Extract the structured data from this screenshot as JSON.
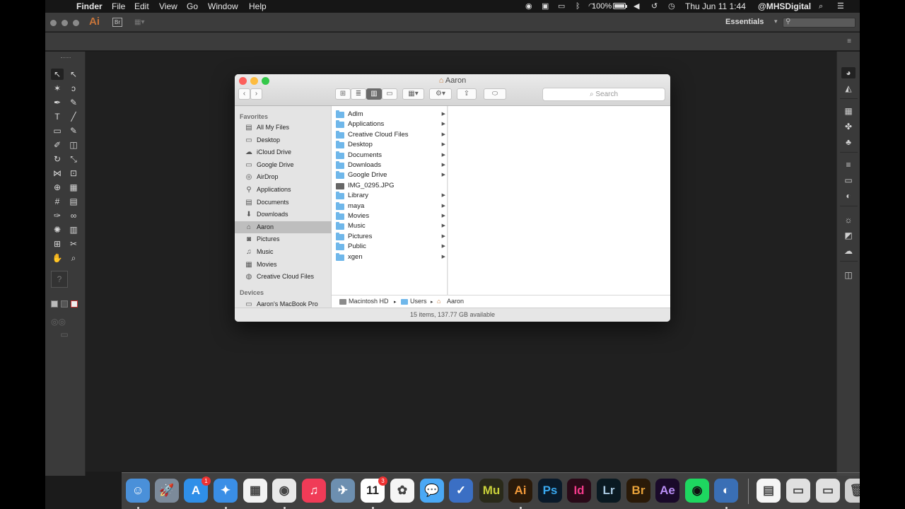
{
  "menubar": {
    "apple": "",
    "app_name": "Finder",
    "menus": [
      "File",
      "Edit",
      "View",
      "Go",
      "Window",
      "Help"
    ],
    "battery": "100%",
    "clock": "Thu Jun 11  1:44",
    "user": "@MHSDigital"
  },
  "illustrator": {
    "logo": "Ai",
    "bridge": "Br",
    "workspace": "Essentials",
    "search_placeholder": "⚲"
  },
  "finder": {
    "title": "Aaron",
    "search_placeholder": "Search",
    "sidebar": {
      "favorites_header": "Favorites",
      "favorites": [
        {
          "label": "All My Files",
          "icon": "all-files-icon"
        },
        {
          "label": "Desktop",
          "icon": "desktop-icon"
        },
        {
          "label": "iCloud Drive",
          "icon": "cloud-icon"
        },
        {
          "label": "Google Drive",
          "icon": "drive-icon"
        },
        {
          "label": "AirDrop",
          "icon": "airdrop-icon"
        },
        {
          "label": "Applications",
          "icon": "applications-icon"
        },
        {
          "label": "Documents",
          "icon": "documents-icon"
        },
        {
          "label": "Downloads",
          "icon": "downloads-icon"
        },
        {
          "label": "Aaron",
          "icon": "home-icon"
        },
        {
          "label": "Pictures",
          "icon": "camera-icon"
        },
        {
          "label": "Music",
          "icon": "music-icon"
        },
        {
          "label": "Movies",
          "icon": "film-icon"
        },
        {
          "label": "Creative Cloud Files",
          "icon": "creative-cloud-icon"
        }
      ],
      "devices_header": "Devices",
      "devices": [
        {
          "label": "Aaron's MacBook Pro",
          "icon": "laptop-icon"
        }
      ]
    },
    "items": [
      {
        "name": "Adlm",
        "folder": true
      },
      {
        "name": "Applications",
        "folder": true
      },
      {
        "name": "Creative Cloud Files",
        "folder": true
      },
      {
        "name": "Desktop",
        "folder": true
      },
      {
        "name": "Documents",
        "folder": true
      },
      {
        "name": "Downloads",
        "folder": true
      },
      {
        "name": "Google Drive",
        "folder": true
      },
      {
        "name": "IMG_0295.JPG",
        "folder": false
      },
      {
        "name": "Library",
        "folder": true
      },
      {
        "name": "maya",
        "folder": true
      },
      {
        "name": "Movies",
        "folder": true
      },
      {
        "name": "Music",
        "folder": true
      },
      {
        "name": "Pictures",
        "folder": true
      },
      {
        "name": "Public",
        "folder": true
      },
      {
        "name": "xgen",
        "folder": true
      }
    ],
    "path": [
      "Macintosh HD",
      "Users",
      "Aaron"
    ],
    "status": "15 items, 137.77 GB available"
  },
  "dock": {
    "apps": [
      {
        "name": "finder-dock-icon",
        "label": "",
        "color": "#4a90d9",
        "text_color": "#fff",
        "running": true
      },
      {
        "name": "launchpad-dock-icon",
        "label": "",
        "color": "#7c8a9a",
        "text_color": "#fff",
        "running": false
      },
      {
        "name": "app-store-dock-icon",
        "label": "A",
        "color": "#2f8fe8",
        "text_color": "#fff",
        "badge": "1",
        "running": false
      },
      {
        "name": "safari-dock-icon",
        "label": "",
        "color": "#3a8ee6",
        "text_color": "#fff",
        "running": true
      },
      {
        "name": "grid-app-dock-icon",
        "label": "",
        "color": "#f2f2f2",
        "text_color": "#444",
        "running": false
      },
      {
        "name": "chrome-dock-icon",
        "label": "",
        "color": "#e8e8e8",
        "text_color": "#444",
        "running": true
      },
      {
        "name": "itunes-dock-icon",
        "label": "♫",
        "color": "#f03b57",
        "text_color": "#fff",
        "running": false
      },
      {
        "name": "preview-dock-icon",
        "label": "",
        "color": "#6d8fb0",
        "text_color": "#fff",
        "running": false
      },
      {
        "name": "calendar-dock-icon",
        "label": "11",
        "color": "#ffffff",
        "text_color": "#222",
        "badge": "3",
        "running": true
      },
      {
        "name": "photos-dock-icon",
        "label": "",
        "color": "#f5f5f5",
        "text_color": "#444",
        "running": false
      },
      {
        "name": "messages-dock-icon",
        "label": "",
        "color": "#4aa8f5",
        "text_color": "#fff",
        "running": false
      },
      {
        "name": "tasks-dock-icon",
        "label": "✓",
        "color": "#3b6fc4",
        "text_color": "#fff",
        "running": false
      },
      {
        "name": "muse-dock-icon",
        "label": "Mu",
        "color": "#2a2a1a",
        "text_color": "#c9d13a",
        "running": false
      },
      {
        "name": "illustrator-dock-icon",
        "label": "Ai",
        "color": "#2a1a0a",
        "text_color": "#f29a3a",
        "running": true
      },
      {
        "name": "photoshop-dock-icon",
        "label": "Ps",
        "color": "#0a1a2a",
        "text_color": "#39a8f0",
        "running": false
      },
      {
        "name": "indesign-dock-icon",
        "label": "Id",
        "color": "#2a0a18",
        "text_color": "#f23a8a",
        "running": false
      },
      {
        "name": "lightroom-dock-icon",
        "label": "Lr",
        "color": "#0a1a22",
        "text_color": "#a8c8e0",
        "running": false
      },
      {
        "name": "bridge-dock-icon",
        "label": "Br",
        "color": "#2a1a08",
        "text_color": "#e8a23a",
        "running": false
      },
      {
        "name": "after-effects-dock-icon",
        "label": "Ae",
        "color": "#1a0a2a",
        "text_color": "#b98ef5",
        "running": false
      },
      {
        "name": "spotify-dock-icon",
        "label": "",
        "color": "#1ed760",
        "text_color": "#111",
        "running": false
      },
      {
        "name": "browser-dock-icon",
        "label": "",
        "color": "#3a6fb5",
        "text_color": "#fff",
        "running": true
      },
      {
        "name": "document-dock-icon",
        "label": "",
        "color": "#f5f5f5",
        "text_color": "#444",
        "running": false
      },
      {
        "name": "folder-stack-dock-icon",
        "label": "",
        "color": "#e0e0e0",
        "text_color": "#444",
        "running": false
      },
      {
        "name": "download-stack-dock-icon",
        "label": "",
        "color": "#e0e0e0",
        "text_color": "#444",
        "running": false
      },
      {
        "name": "trash-dock-icon",
        "label": "",
        "color": "#cfcfcf",
        "text_color": "#444",
        "running": false
      }
    ]
  }
}
